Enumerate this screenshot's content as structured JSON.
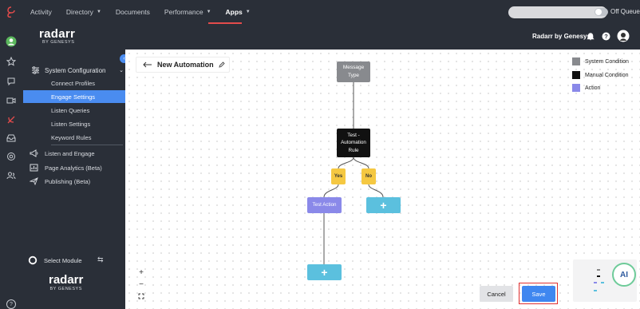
{
  "topnav": {
    "items": [
      {
        "label": "Activity",
        "dropdown": false
      },
      {
        "label": "Directory",
        "dropdown": true
      },
      {
        "label": "Documents",
        "dropdown": false
      },
      {
        "label": "Performance",
        "dropdown": true
      },
      {
        "label": "Apps",
        "dropdown": true,
        "active": true
      }
    ],
    "search_placeholder": "",
    "queue_label": "Off Queue"
  },
  "header": {
    "brand_name": "radarr",
    "brand_sub": "BY GENESYS",
    "account": "Radarr by Genesys"
  },
  "sidebar": {
    "section_label": "System Configuration",
    "sub_items": [
      "Connect Profiles",
      "Engage Settings",
      "Listen Queries",
      "Listen Settings",
      "Keyword Rules"
    ],
    "active_sub": "Engage Settings",
    "menu_items": [
      "Listen and Engage",
      "Page Analytics (Beta)",
      "Publishing (Beta)"
    ],
    "select_module": "Select Module",
    "footer_brand": "radarr",
    "footer_sub": "BY GENESYS"
  },
  "canvas": {
    "title": "New Automation",
    "nodes": {
      "message_type": "Message Type",
      "test_rule": "Test - Automation Rule",
      "yes": "Yes",
      "no": "No",
      "test_action": "Test Action",
      "plus": "+"
    },
    "legend": [
      {
        "label": "System Condition",
        "color": "#888a8e"
      },
      {
        "label": "Manual Condition",
        "color": "#111111"
      },
      {
        "label": "Action",
        "color": "#8a89e9"
      }
    ],
    "zoom_in": "+",
    "zoom_out": "−",
    "ai_label": "AI"
  },
  "footer": {
    "cancel_label": "Cancel",
    "save_label": "Save"
  },
  "colors": {
    "accent": "#3f87f0",
    "nav_bg": "#2a2f38",
    "yes_no": "#f5c842",
    "add_node": "#5bc0de",
    "active_underline": "#e34b4b"
  }
}
